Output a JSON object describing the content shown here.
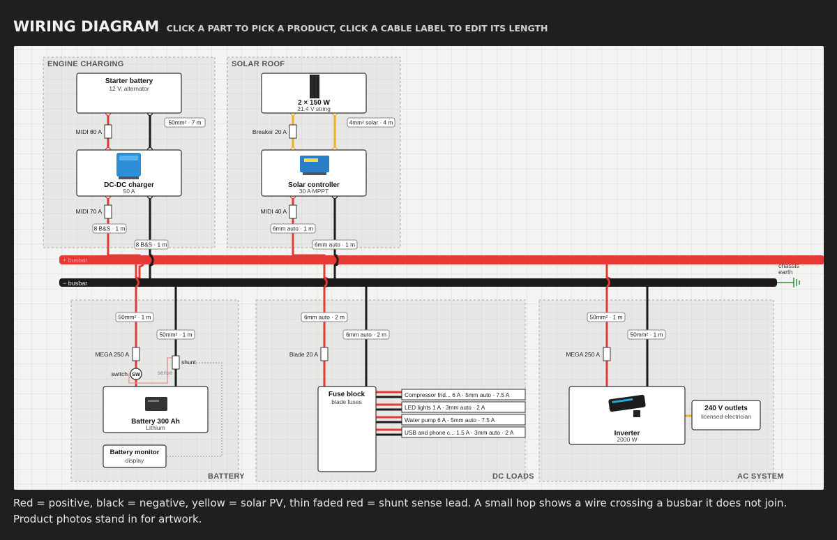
{
  "header": {
    "title": "WIRING DIAGRAM",
    "subtitle": "CLICK A PART TO PICK A PRODUCT, CLICK A CABLE LABEL TO EDIT ITS LENGTH"
  },
  "groups": {
    "engine": "ENGINE CHARGING",
    "solar": "SOLAR ROOF",
    "battery": "BATTERY",
    "dcloads": "DC LOADS",
    "ac": "AC SYSTEM"
  },
  "parts": {
    "starter": {
      "name": "Starter battery",
      "sub": "12 V, alternator"
    },
    "dcdc": {
      "name": "DC-DC charger",
      "sub": "50 A"
    },
    "panels": {
      "name": "2 × 150 W",
      "sub": "21.4 V string"
    },
    "solarctl": {
      "name": "Solar controller",
      "sub": "30 A MPPT"
    },
    "battery": {
      "name": "Battery 300 Ah",
      "sub": "Lithium"
    },
    "monitor": {
      "name": "Battery monitor",
      "sub": "display"
    },
    "fuseblock": {
      "name": "Fuse block",
      "sub": "blade fuses"
    },
    "inverter": {
      "name": "Inverter",
      "sub": "2000 W"
    },
    "outlets": {
      "name": "240 V outlets",
      "sub": "licensed electrician"
    }
  },
  "fuses": {
    "midi80": "MIDI 80 A",
    "midi70": "MIDI 70 A",
    "breaker20": "Breaker 20 A",
    "midi40": "MIDI 40 A",
    "mega250a": "MEGA 250 A",
    "blade20": "Blade 20 A",
    "mega250b": "MEGA 250 A"
  },
  "cables": {
    "starter_neg": "50mm² · 7 m",
    "dcdc_pos": "8 B&S · 1 m",
    "dcdc_neg": "8 B&S · 1 m",
    "solar_pv": "4mm² solar · 4 m",
    "solar_pos": "6mm auto · 1 m",
    "solar_neg": "6mm auto · 1 m",
    "bat_pos": "50mm² · 1 m",
    "bat_neg": "50mm² · 1 m",
    "fuse_pos": "6mm auto · 2 m",
    "fuse_neg": "6mm auto · 2 m",
    "inv_pos": "50mm² · 1 m",
    "inv_neg": "50mm² · 1 m"
  },
  "busbars": {
    "pos": "+ busbar",
    "neg": "− busbar",
    "earth": "chassis earth"
  },
  "misc": {
    "switch": "switch",
    "switch_icon": "SW",
    "shunt": "shunt",
    "sense": "sense"
  },
  "loads": [
    "Compressor frid... 6 A · 5mm auto · 7.5 A",
    "LED lights 1 A · 3mm auto · 2 A",
    "Water pump 6 A · 5mm auto · 7.5 A",
    "USB and phone c... 1.5 A · 3mm auto · 2 A"
  ],
  "footer": "Red = positive, black = negative, yellow = solar PV, thin faded red = shunt sense lead. A small hop shows a wire crossing a busbar it does not join. Product photos stand in for artwork.",
  "colors": {
    "positive": "#e53935",
    "negative": "#1a1a1a",
    "solar": "#f2b01e",
    "sense": "#e89090",
    "earth": "#2e8b3a"
  }
}
